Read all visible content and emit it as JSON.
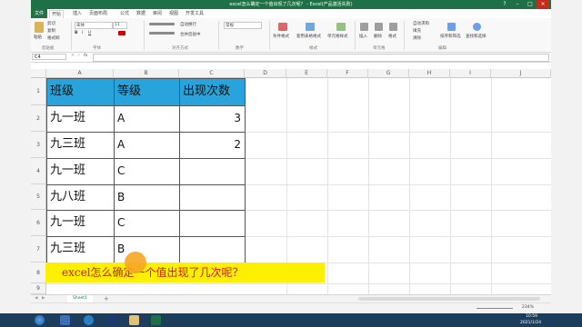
{
  "window": {
    "title": "excel怎么确定一个值出现了几次呢？ - Excel(产品激活失败)",
    "controls": [
      "?",
      "–",
      "□",
      "×"
    ]
  },
  "menu": {
    "items": [
      "文件",
      "开始",
      "插入",
      "页面布局",
      "公式",
      "数据",
      "审阅",
      "视图",
      "开发工具"
    ]
  },
  "ribbon": {
    "clipboard": {
      "paste": "粘贴",
      "cut": "剪切",
      "copy": "复制",
      "format_painter": "格式刷",
      "group": "剪贴板"
    },
    "font": {
      "name": "宋体",
      "size": "11",
      "group": "字体"
    },
    "alignment": {
      "wrap": "自动换行",
      "merge": "合并后居中",
      "group": "对齐方式"
    },
    "number": {
      "format": "常规",
      "group": "数字"
    },
    "styles": {
      "conditional": "条件格式",
      "table": "套用表格格式",
      "cell_styles": "单元格样式",
      "group": "样式"
    },
    "cells": {
      "insert": "插入",
      "delete": "删除",
      "format": "格式",
      "group": "单元格"
    },
    "editing": {
      "autosum": "自动求和",
      "fill": "填充",
      "clear": "清除",
      "sort": "排序和筛选",
      "find": "查找和选择",
      "group": "编辑"
    }
  },
  "formula_bar": {
    "name_box": "C4",
    "cancel": "✕",
    "enter": "✓",
    "fx": "fx",
    "value": ""
  },
  "columns": [
    "A",
    "B",
    "C",
    "D",
    "E",
    "F",
    "G",
    "H",
    "I",
    "J"
  ],
  "rows": [
    "1",
    "2",
    "3",
    "4",
    "5",
    "6",
    "7",
    "8",
    "9"
  ],
  "table": {
    "headers": [
      "班级",
      "等级",
      "出现次数"
    ],
    "rows": [
      [
        "九一班",
        "A",
        "3"
      ],
      [
        "九三班",
        "A",
        "2"
      ],
      [
        "九一班",
        "C",
        ""
      ],
      [
        "九八班",
        "B",
        ""
      ],
      [
        "九一班",
        "C",
        ""
      ],
      [
        "九三班",
        "B",
        ""
      ]
    ]
  },
  "banner": {
    "text": "excel怎么确定一个值出现了几次呢？"
  },
  "sheet_tabs": {
    "active": "Sheet1",
    "add": "+"
  },
  "status": {
    "zoom": "234%"
  },
  "taskbar": {
    "time": "10:59",
    "date": "2021/1/24"
  },
  "colors": {
    "excel_green": "#1e7145",
    "header_fill": "#29a3dc",
    "banner_fill": "#ffef00",
    "banner_text": "#c81e1e"
  }
}
